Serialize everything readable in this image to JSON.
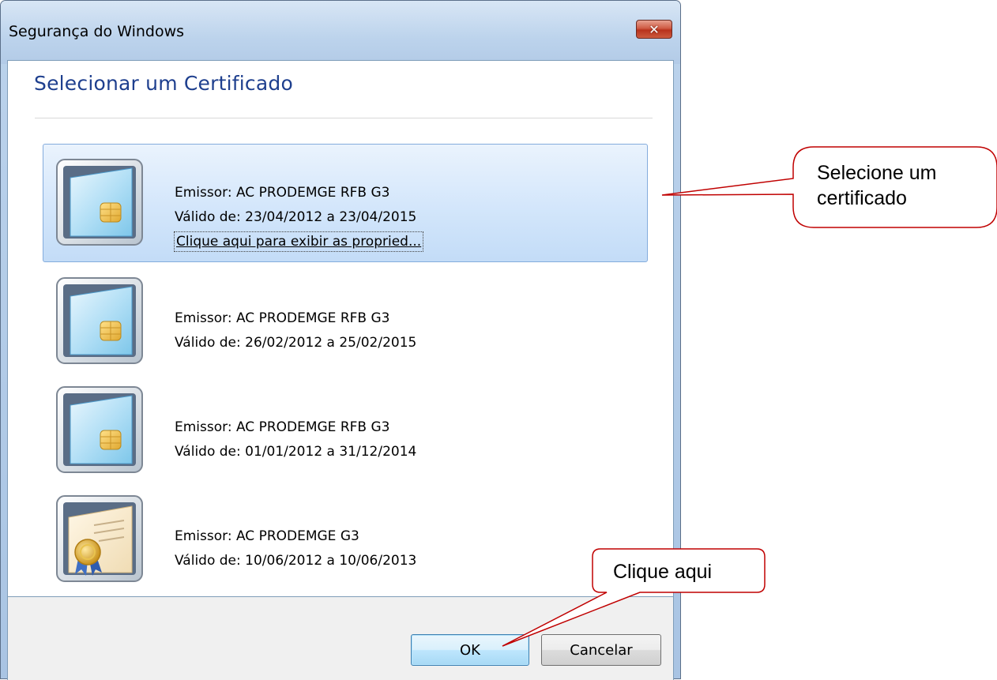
{
  "window": {
    "title": "Segurança do Windows",
    "close_symbol": "✕"
  },
  "dialog": {
    "heading": "Selecionar um Certificado",
    "certificates": [
      {
        "issuer": "Emissor: AC PRODEMGE RFB G3",
        "validity": "Válido de: 23/04/2012 a 23/04/2015",
        "link": "Clique aqui para exibir as propried...",
        "icon": "smartcard-icon",
        "selected": true
      },
      {
        "issuer": "Emissor: AC PRODEMGE RFB G3",
        "validity": "Válido de: 26/02/2012 a 25/02/2015",
        "icon": "smartcard-icon"
      },
      {
        "issuer": "Emissor: AC PRODEMGE RFB G3",
        "validity": "Válido de: 01/01/2012 a 31/12/2014",
        "icon": "smartcard-icon"
      },
      {
        "issuer": "Emissor: AC PRODEMGE G3",
        "validity": "Válido de: 10/06/2012 a 10/06/2013",
        "icon": "certificate-seal-icon"
      }
    ],
    "buttons": {
      "ok": "OK",
      "cancel": "Cancelar"
    }
  },
  "callouts": {
    "select_line1": "Selecione um",
    "select_line2": "certificado",
    "click": "Clique aqui"
  },
  "colors": {
    "heading": "#1e3f8e",
    "selection": "#c3dcf7",
    "callout_border": "#c00000"
  }
}
